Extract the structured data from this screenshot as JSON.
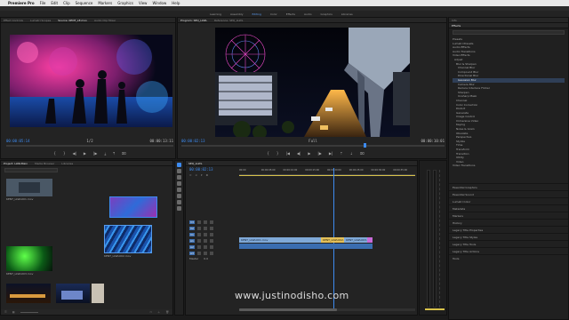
{
  "menubar": {
    "app": "Premiere Pro",
    "items": [
      "File",
      "Edit",
      "Clip",
      "Sequence",
      "Markers",
      "Graphics",
      "View",
      "Window",
      "Help"
    ]
  },
  "workspaces": [
    "Learning",
    "Assembly",
    "Editing",
    "Color",
    "Effects",
    "Audio",
    "Graphics",
    "Libraries"
  ],
  "source_monitor": {
    "tabs": [
      "Effect Controls",
      "Lumetri Scopes",
      "Source: KENT_LE.mov",
      "Audio Clip Mixer"
    ],
    "timecode_left": "00:00:05:14",
    "timecode_right": "00:00:13:11",
    "fit": "1/2"
  },
  "program_monitor": {
    "tabs": [
      "Program: SEQ_LLWL",
      "Reference: SEQ_LLWL"
    ],
    "timecode_left": "00:00:02:13",
    "timecode_right": "00:00:10:01",
    "fit": "Full"
  },
  "project_panel": {
    "tabs": [
      "Project: LLWLMain",
      "Media Browser",
      "Libraries"
    ],
    "clips": [
      {
        "name": "KENT_LLWL001.mov"
      },
      {
        "name": "KENT_LLWL002.mov"
      },
      {
        "name": "KENT_LLWL003.mov"
      },
      {
        "name": "KENT_LLWL004.mov"
      },
      {
        "name": "KENT_LLWL005.mov"
      }
    ]
  },
  "timeline": {
    "tab": "SEQ_LLWL",
    "timecode": "00:00:02:13",
    "ruler": [
      "00:00",
      "00:00:05:00",
      "00:00:10:00",
      "00:00:15:00",
      "00:00:20:00",
      "00:00:25:00",
      "00:00:30:00",
      "00:00:35:00"
    ],
    "video_tracks": [
      "V3",
      "V2",
      "V1"
    ],
    "audio_tracks": [
      "A1",
      "A2",
      "A3"
    ],
    "master": "Master",
    "master_value": "0.0",
    "clip_labels": [
      "KENT_LLWL001.mov",
      "KENT_LLWL002.mov",
      "KENT_LLWL003.mov"
    ]
  },
  "effects_panel": {
    "title": "Effects",
    "tree": [
      "Presets",
      "Lumetri Presets",
      "Audio Effects",
      "Audio Transitions",
      "Video Effects",
      "Adjust",
      "Blur & Sharpen",
      "Channel Blur",
      "Compound Blur",
      "Directional Blur",
      "Gaussian Blur",
      "Camera Blur",
      "Reduce Interlace Flicker",
      "Sharpen",
      "Unsharp Mask",
      "Channel",
      "Color Correction",
      "Distort",
      "Generate",
      "Image Control",
      "Immersive Video",
      "Keying",
      "Noise & Grain",
      "Obsolete",
      "Perspective",
      "Stylize",
      "Time",
      "Transform",
      "Transition",
      "Utility",
      "Video",
      "Video Transitions"
    ],
    "sections": [
      "Essential Graphics",
      "Essential Sound",
      "Lumetri Color",
      "Metadata",
      "Markers",
      "History",
      "Legacy Title Properties",
      "Legacy Title Styles",
      "Legacy Title Tools",
      "Legacy Title Actions",
      "Tools"
    ]
  },
  "watermark": "www.justinodisho.com",
  "colors": {
    "accent": "#3d8bf0",
    "clip_video": "#7fa9d8",
    "clip_audio": "#3a6db0",
    "clip_label": "#e3c05a",
    "playhead": "#3d8bf0"
  }
}
